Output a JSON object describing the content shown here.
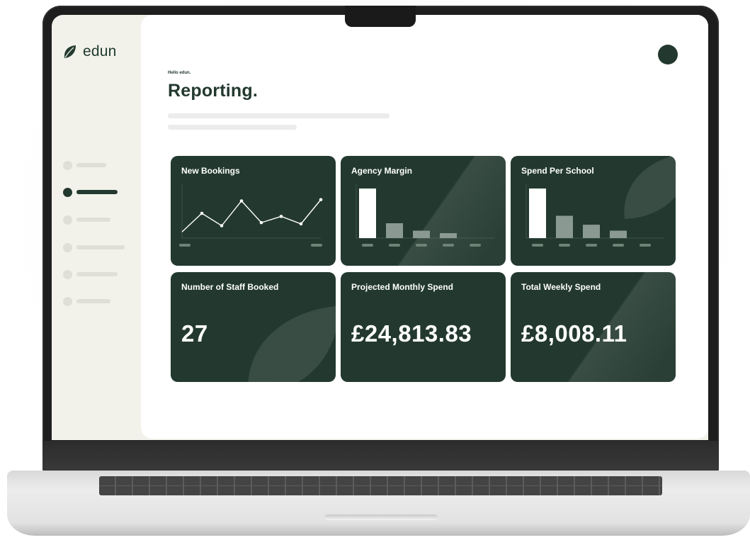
{
  "app": {
    "brand": "edun",
    "greeting": "Hello edun.",
    "title": "Reporting."
  },
  "colors": {
    "primary": "#23392f",
    "sidebar_bg": "#f2f1ea",
    "placeholder": "#e0dfd7"
  },
  "sidebar": {
    "items": [
      {
        "state": "inactive"
      },
      {
        "state": "active"
      },
      {
        "state": "inactive"
      },
      {
        "state": "inactive"
      },
      {
        "state": "inactive"
      },
      {
        "state": "inactive"
      }
    ]
  },
  "cards": {
    "new_bookings": {
      "title": "New Bookings"
    },
    "agency_margin": {
      "title": "Agency Margin"
    },
    "spend_per_school": {
      "title": "Spend Per School"
    },
    "staff_booked": {
      "title": "Number of Staff Booked",
      "value": "27"
    },
    "monthly_spend": {
      "title": "Projected Monthly Spend",
      "value": "£24,813.83"
    },
    "weekly_spend": {
      "title": "Total Weekly Spend",
      "value": "£8,008.11"
    }
  },
  "chart_data": [
    {
      "type": "line",
      "title": "New Bookings",
      "x": [
        1,
        2,
        3,
        4,
        5,
        6,
        7
      ],
      "values": [
        1,
        4,
        2,
        6,
        2.5,
        3.5,
        2.3,
        6.2
      ],
      "ylim": [
        0,
        8
      ]
    },
    {
      "type": "bar",
      "title": "Agency Margin",
      "values": [
        10,
        3,
        1.5,
        1,
        0
      ],
      "highlight_index": 0,
      "ylim": [
        0,
        10
      ]
    },
    {
      "type": "bar",
      "title": "Spend Per School",
      "values": [
        10,
        4.5,
        2.7,
        1.5,
        0
      ],
      "highlight_index": 0,
      "ylim": [
        0,
        10
      ]
    }
  ]
}
